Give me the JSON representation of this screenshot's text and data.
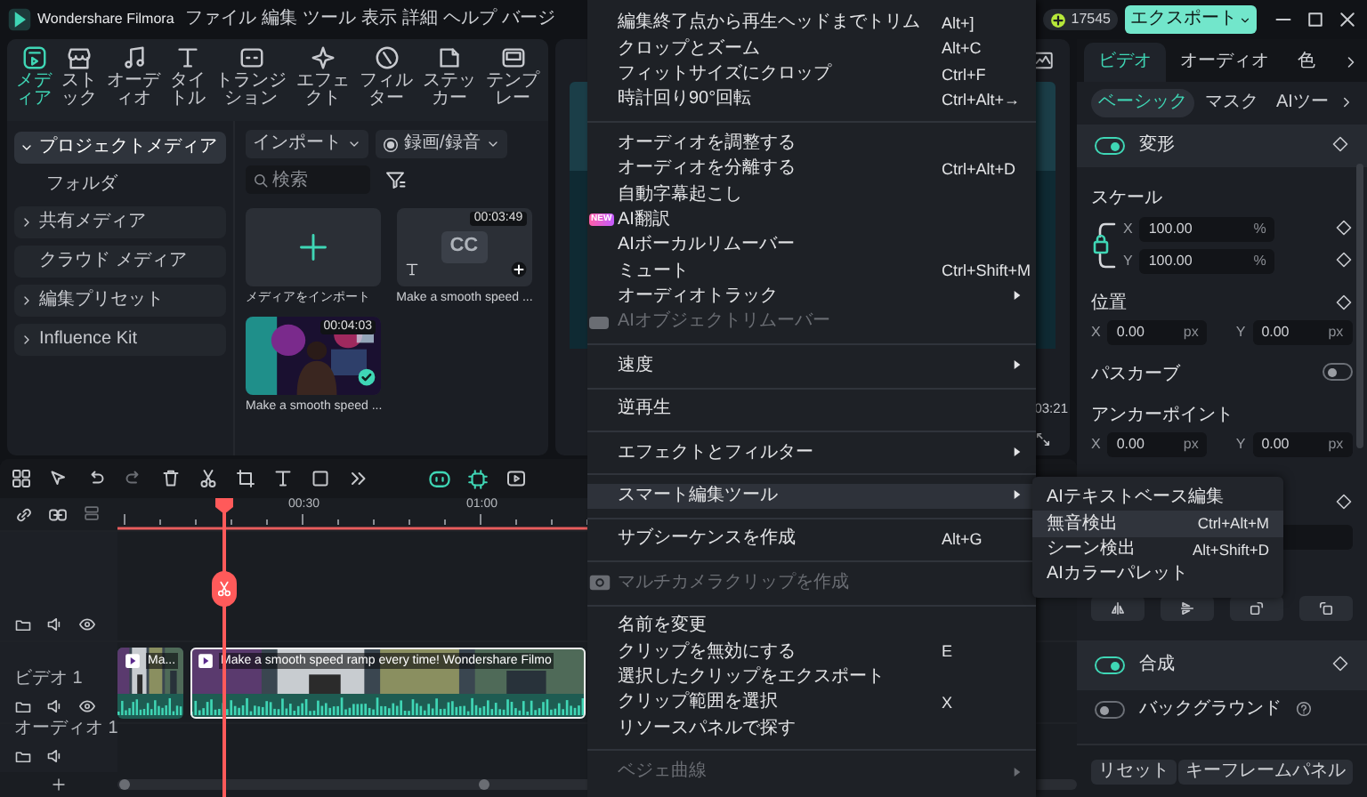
{
  "title_bar": {
    "app_name": "Wondershare Filmora",
    "menus": [
      "ファイル",
      "編集",
      "ツール",
      "表示",
      "詳細",
      "ヘルプ",
      "バージ"
    ],
    "coins": "17545",
    "export_button": "エクスポート"
  },
  "media_tabs": [
    {
      "label": "メディア",
      "selected": true
    },
    {
      "label": "ストック",
      "selected": false
    },
    {
      "label": "オーディオ",
      "selected": false
    },
    {
      "label": "タイトル",
      "selected": false
    },
    {
      "label": "トランジション",
      "selected": false
    },
    {
      "label": "エフェクト",
      "selected": false
    },
    {
      "label": "フィルター",
      "selected": false
    },
    {
      "label": "ステッカー",
      "selected": false
    },
    {
      "label": "テンプレー",
      "selected": false
    }
  ],
  "sidebar": {
    "items": [
      {
        "kind": "group",
        "label": "プロジェクトメディア",
        "expanded": true,
        "selected": true,
        "children": [
          {
            "label": "フォルダ",
            "selected": false
          }
        ]
      },
      {
        "kind": "group",
        "label": "共有メディア",
        "expanded": false,
        "selected": false
      },
      {
        "kind": "item",
        "label": "クラウド メディア",
        "selected": false
      },
      {
        "kind": "group",
        "label": "編集プリセット",
        "expanded": false,
        "selected": false
      },
      {
        "kind": "group",
        "label": "Influence Kit",
        "expanded": false,
        "selected": false
      }
    ]
  },
  "media_toolbar": {
    "import_button": "インポート",
    "record_button": "録画/録音",
    "search": {
      "placeholder": "検索"
    }
  },
  "media_items": [
    {
      "kind": "import",
      "label": "メディアをインポート"
    },
    {
      "kind": "title",
      "badge": "CC",
      "duration": "00:03:49",
      "label": "Make a smooth speed ..."
    },
    {
      "kind": "video",
      "duration": "00:04:03",
      "label": "Make a smooth speed ...",
      "in_use": true
    }
  ],
  "preview": {
    "time": "03:21"
  },
  "context_menu": {
    "items": [
      {
        "kind": "item",
        "label": "編集終了点から再生ヘッドまでトリム",
        "shortcut": "Alt+]",
        "submenu": false,
        "disabled": false,
        "selected": false
      },
      {
        "kind": "item",
        "label": "クロップとズーム",
        "shortcut": "Alt+C",
        "submenu": false,
        "disabled": false,
        "selected": false
      },
      {
        "kind": "item",
        "label": "フィットサイズにクロップ",
        "shortcut": "Ctrl+F",
        "submenu": false,
        "disabled": false,
        "selected": false
      },
      {
        "kind": "item",
        "label": "時計回り90°回転",
        "shortcut": "Ctrl+Alt+→",
        "submenu": false,
        "disabled": false,
        "selected": false
      },
      {
        "kind": "separator"
      },
      {
        "kind": "item",
        "label": "オーディオを調整する",
        "submenu": false,
        "disabled": false,
        "selected": false
      },
      {
        "kind": "item",
        "label": "オーディオを分離する",
        "shortcut": "Ctrl+Alt+D",
        "submenu": false,
        "disabled": false,
        "selected": false
      },
      {
        "kind": "item",
        "label": "自動字幕起こし",
        "submenu": false,
        "disabled": false,
        "selected": false
      },
      {
        "kind": "new-item",
        "badge": "NEW",
        "label": "AI翻訳",
        "submenu": false,
        "disabled": false,
        "selected": false
      },
      {
        "kind": "item",
        "label": "AIボーカルリムーバー",
        "submenu": false,
        "disabled": false,
        "selected": false
      },
      {
        "kind": "item",
        "label": "ミュート",
        "shortcut": "Ctrl+Shift+M",
        "submenu": false,
        "disabled": false,
        "selected": false
      },
      {
        "kind": "item",
        "label": "オーディオトラック",
        "submenu": true,
        "disabled": false,
        "selected": false
      },
      {
        "kind": "badge-item",
        "label": "AIオブジェクトリムーバー",
        "submenu": false,
        "disabled": true,
        "selected": false
      },
      {
        "kind": "separator"
      },
      {
        "kind": "item",
        "label": "速度",
        "submenu": true,
        "disabled": false,
        "selected": false
      },
      {
        "kind": "separator"
      },
      {
        "kind": "item",
        "label": "逆再生",
        "submenu": false,
        "disabled": false,
        "selected": false
      },
      {
        "kind": "separator"
      },
      {
        "kind": "item",
        "label": "エフェクトとフィルター",
        "submenu": true,
        "disabled": false,
        "selected": false
      },
      {
        "kind": "separator"
      },
      {
        "kind": "item",
        "label": "スマート編集ツール",
        "submenu": true,
        "disabled": false,
        "selected": true
      },
      {
        "kind": "separator"
      },
      {
        "kind": "item",
        "label": "サブシーケンスを作成",
        "shortcut": "Alt+G",
        "submenu": false,
        "disabled": false,
        "selected": false
      },
      {
        "kind": "separator"
      },
      {
        "kind": "camera-item",
        "label": "マルチカメラクリップを作成",
        "submenu": false,
        "disabled": true,
        "selected": false
      },
      {
        "kind": "separator"
      },
      {
        "kind": "item",
        "label": "名前を変更",
        "submenu": false,
        "disabled": false,
        "selected": false
      },
      {
        "kind": "item",
        "label": "クリップを無効にする",
        "shortcut": "E",
        "submenu": false,
        "disabled": false,
        "selected": false
      },
      {
        "kind": "item",
        "label": "選択したクリップをエクスポート",
        "submenu": false,
        "disabled": false,
        "selected": false
      },
      {
        "kind": "item",
        "label": "クリップ範囲を選択",
        "shortcut": "X",
        "submenu": false,
        "disabled": false,
        "selected": false
      },
      {
        "kind": "item",
        "label": "リソースパネルで探す",
        "submenu": false,
        "disabled": false,
        "selected": false
      },
      {
        "kind": "separator"
      },
      {
        "kind": "item",
        "label": "ベジェ曲線",
        "submenu": true,
        "disabled": true,
        "selected": false
      }
    ]
  },
  "submenu": {
    "items": [
      {
        "label": "AIテキストベース編集",
        "selected": false
      },
      {
        "label": "無音検出",
        "shortcut": "Ctrl+Alt+M",
        "selected": true
      },
      {
        "label": "シーン検出",
        "shortcut": "Alt+Shift+D",
        "selected": false
      },
      {
        "label": "AIカラーパレット",
        "selected": false
      }
    ]
  },
  "inspector": {
    "tabs": [
      {
        "label": "ビデオ",
        "selected": true
      },
      {
        "label": "オーディオ",
        "selected": false
      },
      {
        "label": "色",
        "selected": false
      }
    ],
    "subtabs": [
      {
        "label": "ベーシック",
        "selected": true
      },
      {
        "label": "マスク",
        "selected": false
      },
      {
        "label": "AIツー",
        "selected": false
      }
    ],
    "transform": {
      "label": "変形",
      "on": true
    },
    "scale": {
      "label": "スケール",
      "x": {
        "axis": "X",
        "value": "100.00",
        "unit": "%"
      },
      "y": {
        "axis": "Y",
        "value": "100.00",
        "unit": "%"
      }
    },
    "position": {
      "label": "位置",
      "x": {
        "axis": "X",
        "value": "0.00",
        "unit": "px"
      },
      "y": {
        "axis": "Y",
        "value": "0.00",
        "unit": "px"
      }
    },
    "path_curve": {
      "label": "パスカーブ",
      "on": false
    },
    "anchor": {
      "label": "アンカーポイント",
      "x": {
        "axis": "X",
        "value": "0.00",
        "unit": "px"
      },
      "y": {
        "axis": "Y",
        "value": "0.00",
        "unit": "px"
      }
    },
    "composite": {
      "label": "合成",
      "on": true
    },
    "background": {
      "label": "バックグラウンド",
      "on": false
    },
    "buttons": [
      "リセット",
      "キーフレームパネル"
    ]
  },
  "timeline": {
    "ruler": [
      "00:30",
      "01:00"
    ],
    "tracks": [
      {
        "kind": "video"
      },
      {
        "kind": "video",
        "label": "ビデオ 1",
        "clips": [
          {
            "title": "Ma...",
            "selected": false
          },
          {
            "title": "Make a smooth speed ramp every time! Wondershare Filmo",
            "selected": true
          }
        ]
      },
      {
        "kind": "audio",
        "label": "オーディオ 1"
      }
    ]
  }
}
